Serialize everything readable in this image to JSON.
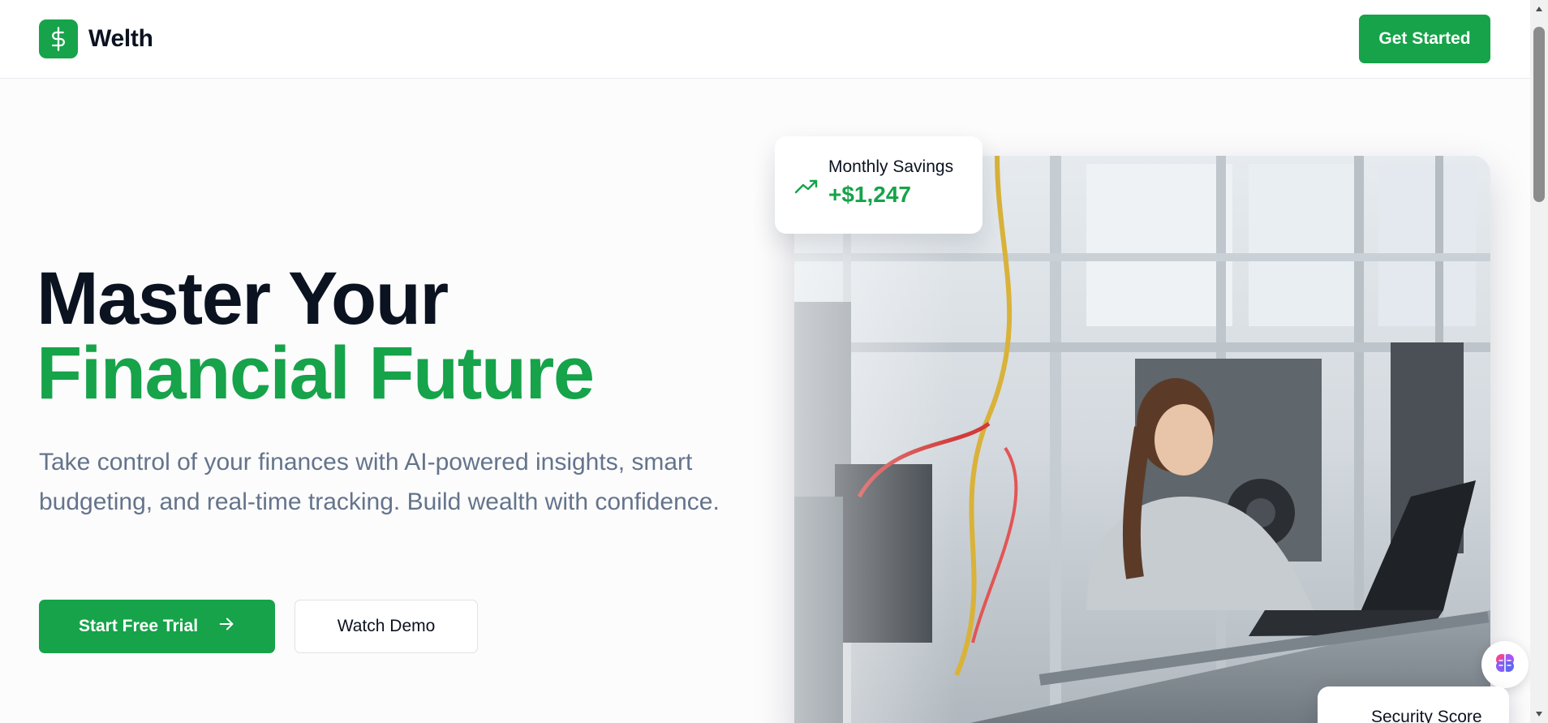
{
  "header": {
    "brand_name": "Welth",
    "cta_label": "Get Started"
  },
  "hero": {
    "title_line1": "Master Your",
    "title_line2": "Financial Future",
    "description": "Take control of your finances with AI-powered insights, smart budgeting, and real-time tracking. Build wealth with confidence.",
    "primary_button": "Start Free Trial",
    "secondary_button": "Watch Demo"
  },
  "stat_card": {
    "label": "Monthly Savings",
    "value": "+$1,247",
    "icon": "trending-up-icon"
  },
  "security_card": {
    "label": "Security Score"
  },
  "icons": {
    "logo": "dollar-sign-icon",
    "cta_arrow": "arrow-right-icon",
    "assistant": "brain-icon"
  },
  "colors": {
    "accent": "#16a34a",
    "heading": "#0b1220",
    "body_text": "#64748b",
    "background": "#fcfcfd"
  }
}
